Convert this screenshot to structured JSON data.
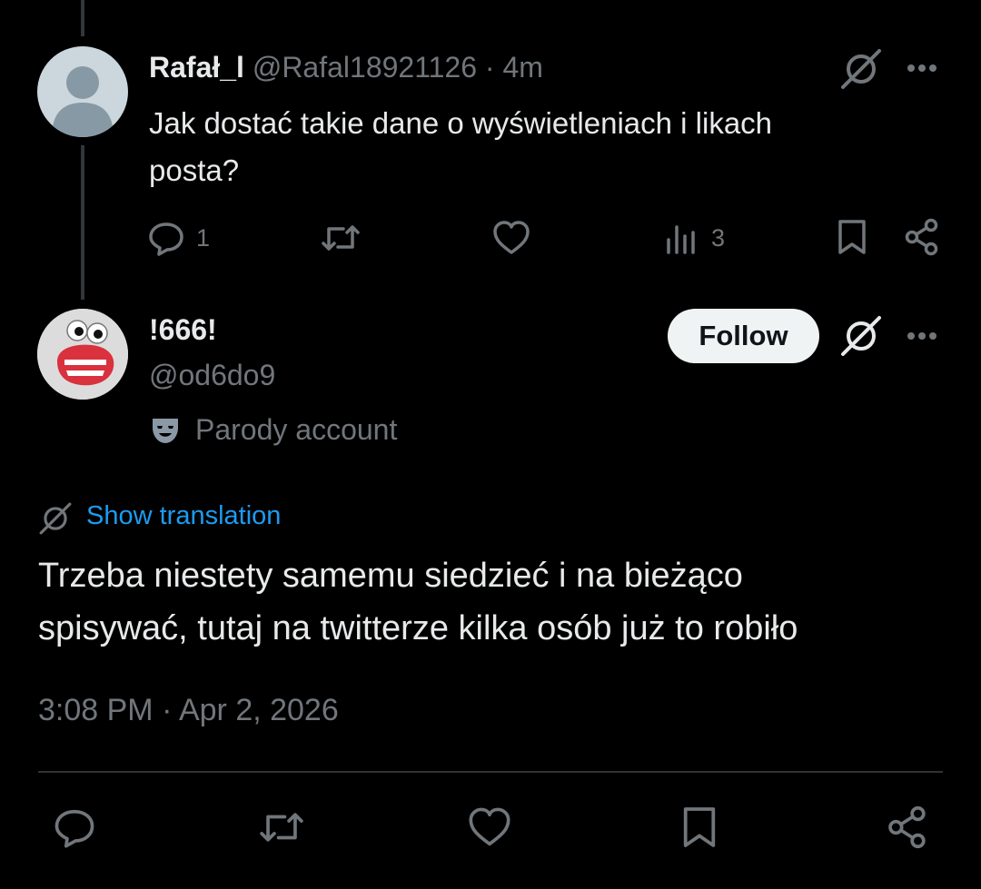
{
  "reply": {
    "display_name": "Rafał_l",
    "handle": "@Rafal18921126",
    "separator": "·",
    "time": "4m",
    "text_line1": "Jak dostać takie dane o wyświetleniach i likach",
    "text_line2": "posta?",
    "actions": {
      "reply_count": "1",
      "views_count": "3"
    },
    "icons": [
      "grok-icon",
      "more-icon",
      "reply-icon",
      "retweet-icon",
      "like-icon",
      "views-icon",
      "bookmark-icon",
      "share-icon"
    ]
  },
  "main_post": {
    "display_name": "!666!",
    "handle": "@od6do9",
    "follow_label": "Follow",
    "parody_label": "Parody account",
    "show_translation_label": "Show translation",
    "text_line1": "Trzeba niestety samemu siedzieć i na bieżąco",
    "text_line2": "spisywać, tutaj na twitterze kilka osób już to robiło",
    "timestamp": "3:08 PM · Apr 2, 2026",
    "icons": [
      "grok-icon",
      "more-icon",
      "parody-mask-icon",
      "translate-icon",
      "reply-icon",
      "retweet-icon",
      "like-icon",
      "bookmark-icon",
      "share-icon"
    ]
  },
  "colors": {
    "background": "#000000",
    "text": "#e7e9ea",
    "muted": "#71767b",
    "link": "#1d9bf0",
    "follow_bg": "#eff3f4",
    "divider": "#2f3336"
  }
}
